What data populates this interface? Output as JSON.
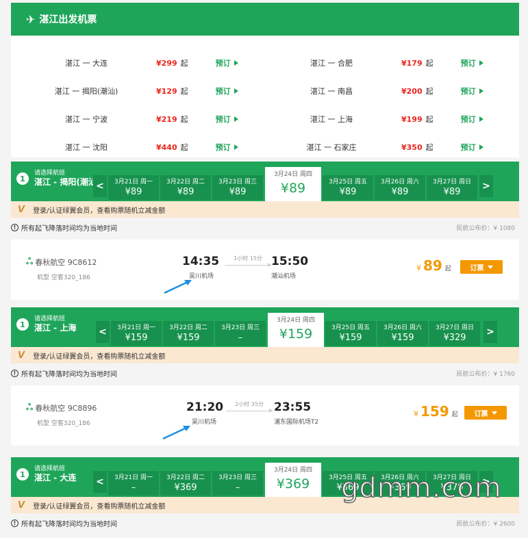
{
  "panel": {
    "title": "湛江出发机票",
    "routes": [
      {
        "route": "湛江 一 大连",
        "price": "¥299",
        "qi": "起",
        "book": "预订"
      },
      {
        "route": "湛江 一 合肥",
        "price": "¥179",
        "qi": "起",
        "book": "预订"
      },
      {
        "route": "湛江 一 揭阳(潮汕)",
        "price": "¥129",
        "qi": "起",
        "book": "预订"
      },
      {
        "route": "湛江 一 南昌",
        "price": "¥200",
        "qi": "起",
        "book": "预订"
      },
      {
        "route": "湛江 一 宁波",
        "price": "¥219",
        "qi": "起",
        "book": "预订"
      },
      {
        "route": "湛江 一 上海",
        "price": "¥199",
        "qi": "起",
        "book": "预订"
      },
      {
        "route": "湛江 一 沈阳",
        "price": "¥440",
        "qi": "起",
        "book": "预订"
      },
      {
        "route": "湛江 一 石家庄",
        "price": "¥350",
        "qi": "起",
        "book": "预订"
      }
    ]
  },
  "sections": [
    {
      "num": "1",
      "select_label": "请选择航班",
      "route_name": "湛江 - 揭阳(潮汕)",
      "prev": "<",
      "next": ">",
      "dates": [
        {
          "date": "3月21日 周一",
          "price": "¥89"
        },
        {
          "date": "3月22日 周二",
          "price": "¥89"
        },
        {
          "date": "3月23日 周三",
          "price": "¥89"
        },
        {
          "date": "3月24日 周四",
          "price": "¥89",
          "active": true
        },
        {
          "date": "3月25日 周五",
          "price": "¥89"
        },
        {
          "date": "3月26日 周六",
          "price": "¥89"
        },
        {
          "date": "3月27日 周日",
          "price": "¥89"
        }
      ],
      "member": "登录/认证绿翼会员，查看购票随机立减金额",
      "tz": "所有起飞降落时间均为当地时间",
      "official": "民航公布价：¥ 1080",
      "flight": {
        "airline": "春秋航空 9C8612",
        "craft": "机型 空客320_186",
        "dep_time": "14:35",
        "dep_port": "吴川机场",
        "duration": "1小时 15分",
        "arr_time": "15:50",
        "arr_port": "潮汕机场",
        "yen": "¥",
        "price": "89",
        "qi": "起",
        "order": "订票"
      }
    },
    {
      "num": "1",
      "select_label": "请选择航班",
      "route_name": "湛江 - 上海",
      "prev": "<",
      "next": ">",
      "dates": [
        {
          "date": "3月21日 周一",
          "price": "¥159"
        },
        {
          "date": "3月22日 周二",
          "price": "¥159"
        },
        {
          "date": "3月23日 周三",
          "price": "–"
        },
        {
          "date": "3月24日 周四",
          "price": "¥159",
          "active": true
        },
        {
          "date": "3月25日 周五",
          "price": "¥159"
        },
        {
          "date": "3月26日 周六",
          "price": "¥159"
        },
        {
          "date": "3月27日 周日",
          "price": "¥329"
        }
      ],
      "member": "登录/认证绿翼会员，查看购票随机立减金额",
      "tz": "所有起飞降落时间均为当地时间",
      "official": "民航公布价：¥ 1760",
      "flight": {
        "airline": "春秋航空 9C8896",
        "craft": "机型 空客320_186",
        "dep_time": "21:20",
        "dep_port": "吴川机场",
        "duration": "2小时 35分",
        "arr_time": "23:55",
        "arr_port": "浦东国际机场T2",
        "yen": "¥",
        "price": "159",
        "qi": "起",
        "order": "订票"
      }
    },
    {
      "num": "1",
      "select_label": "请选择航班",
      "route_name": "湛江 - 大连",
      "prev": "<",
      "next": ">",
      "dates": [
        {
          "date": "3月21日 周一",
          "price": "–"
        },
        {
          "date": "3月22日 周二",
          "price": "¥369"
        },
        {
          "date": "3月23日 周三",
          "price": "–"
        },
        {
          "date": "3月24日 周四",
          "price": "¥369",
          "active": true
        },
        {
          "date": "3月25日 周五",
          "price": "¥369"
        },
        {
          "date": "3月26日 周六",
          "price": "¥369"
        },
        {
          "date": "3月27日 周日",
          "price": "¥379"
        }
      ],
      "member": "登录/认证绿翼会员，查看购票随机立减金额",
      "tz": "所有起飞降落时间均为当地时间",
      "official": "民航公布价：¥ 2600"
    }
  ],
  "watermark": "gdmm.com",
  "colors": {
    "green": "#1fa55a",
    "dark_green": "#17914d",
    "orange": "#f39800",
    "red": "#e8261c",
    "member_bg": "#fbe8d1"
  }
}
